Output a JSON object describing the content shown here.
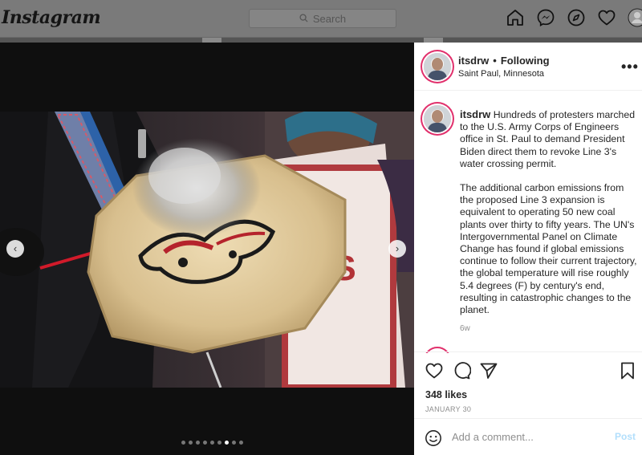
{
  "header": {
    "logo_text": "Instagram",
    "search_placeholder": "Search",
    "nav_icons": [
      "home-icon",
      "messenger-icon",
      "explore-icon",
      "heart-icon",
      "profile-avatar-icon"
    ]
  },
  "media": {
    "carousel_total": 9,
    "carousel_active_index": 6,
    "prev_icon": "chevron-left-icon",
    "next_icon": "chevron-right-icon",
    "sign_text": "ES"
  },
  "post": {
    "username": "itsdrw",
    "separator": "•",
    "follow_status": "Following",
    "location": "Saint Paul, Minnesota",
    "more_label": "•••",
    "caption_paragraphs": [
      "Hundreds of protesters marched to the U.S. Army Corps of Engineers office in St. Paul to demand President Biden direct them to revoke Line 3's water crossing permit.",
      "The additional carbon emissions from the proposed Line 3 expansion is equivalent to operating 50 new coal plants over thirty to fifty years. The UN's Intergovernmental Panel on Climate Change has found if global emissions continue to follow their current trajectory, the global temperature will rise roughly 5.4 degrees (F) by century's end, resulting in catastrophic changes to the planet."
    ],
    "time_ago": "6w",
    "likes": "348 likes",
    "date": "JANUARY 30",
    "comment_placeholder": "Add a comment...",
    "post_label": "Post"
  },
  "colors": {
    "story_ring": "#e1306c",
    "post_button_disabled": "#b2dffc",
    "overlay": "#555555"
  }
}
